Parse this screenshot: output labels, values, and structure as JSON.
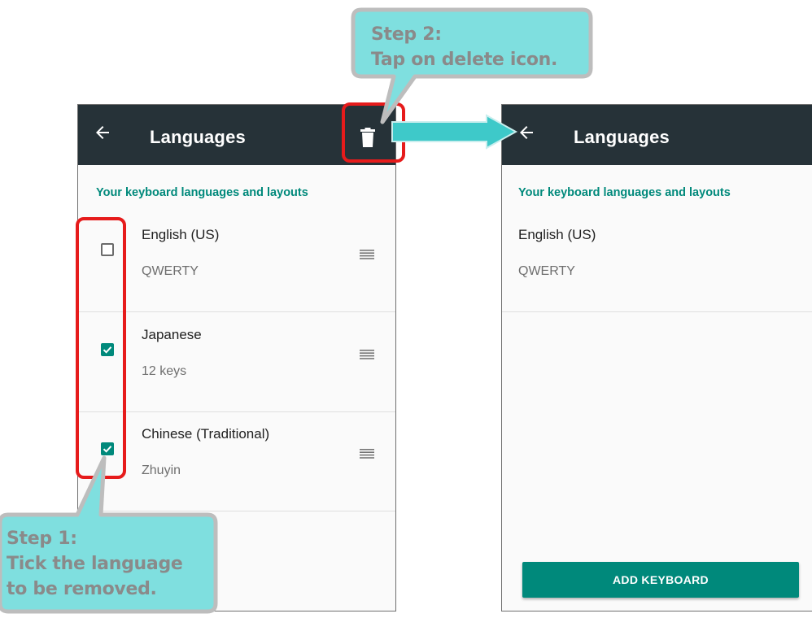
{
  "left_screen": {
    "title": "Languages",
    "section_title": "Your keyboard languages and layouts",
    "items": [
      {
        "label": "English (US)",
        "sub": "QWERTY",
        "checked": false
      },
      {
        "label": "Japanese",
        "sub": "12 keys",
        "checked": true
      },
      {
        "label": "Chinese (Traditional)",
        "sub": "Zhuyin",
        "checked": true
      }
    ]
  },
  "right_screen": {
    "title": "Languages",
    "section_title": "Your keyboard languages and layouts",
    "items": [
      {
        "label": "English (US)",
        "sub": "QWERTY"
      }
    ],
    "add_button_label": "ADD KEYBOARD"
  },
  "callouts": {
    "step2": {
      "line1": "Step 2:",
      "line2": "Tap on delete icon."
    },
    "step1": {
      "line1": "Step 1:",
      "line2": "Tick the language",
      "line3": "to be removed."
    }
  },
  "colors": {
    "appbar": "#263238",
    "accent": "#00897b",
    "callout_fill": "#7fdfdf",
    "callout_border": "#bdbdbd",
    "highlight": "#e61b1b",
    "arrow": "#3ec9c9"
  },
  "icons": {
    "back": "arrow-left-icon",
    "delete": "trash-icon",
    "reorder": "drag-handle-icon",
    "checkbox": "checkbox-icon"
  }
}
